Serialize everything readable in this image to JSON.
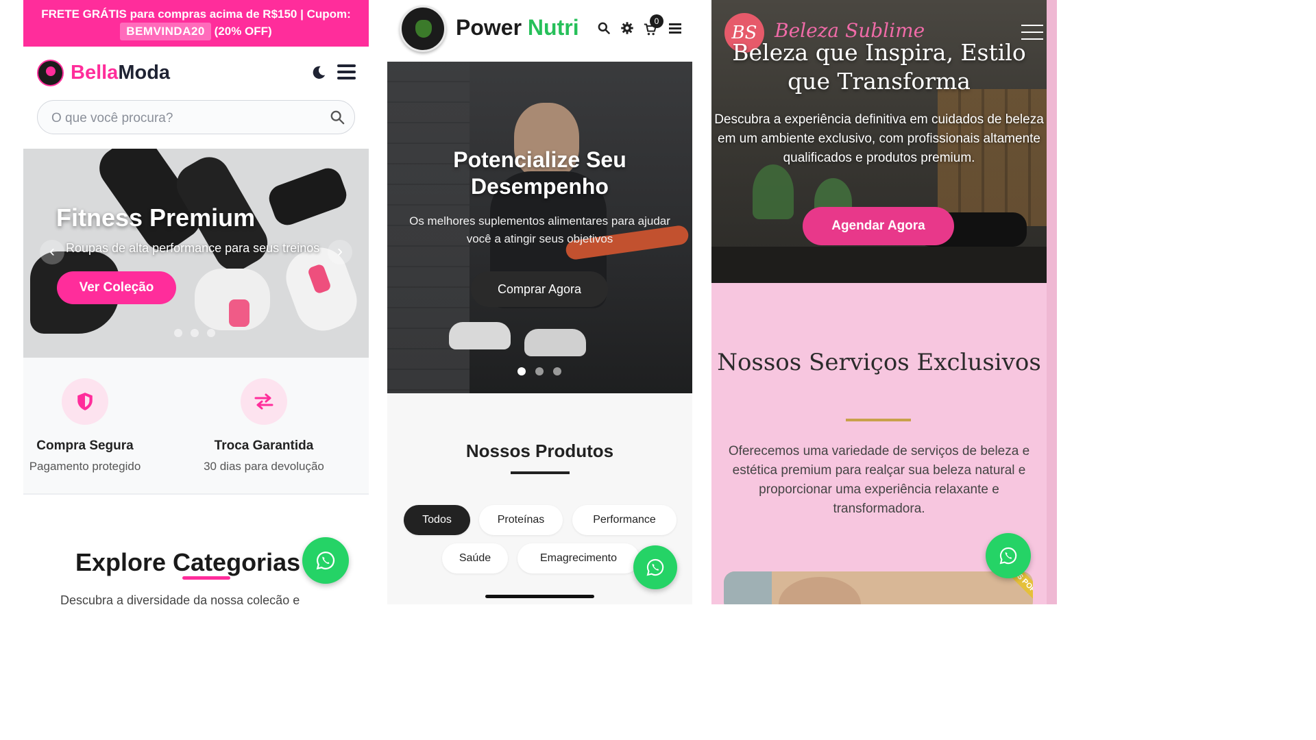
{
  "bellamoda": {
    "promo": {
      "line1": "FRETE GRÁTIS para compras acima de R$150 | Cupom:",
      "coupon": "BEMVINDA20",
      "discount": "(20% OFF)"
    },
    "brand": {
      "part1": "Bella",
      "part2": "Moda"
    },
    "search": {
      "placeholder": "O que você procura?"
    },
    "hero": {
      "title": "Fitness Premium",
      "subtitle": "Roupas de alta performance para seus treinos",
      "cta": "Ver Coleção",
      "slides": 3,
      "active_slide": 1
    },
    "features": [
      {
        "title": "Compra Segura",
        "subtitle": "Pagamento protegido",
        "icon": "shield-icon"
      },
      {
        "title": "Troca Garantida",
        "subtitle": "30 dias para devolução",
        "icon": "exchange-arrows-icon"
      }
    ],
    "section": {
      "title": "Explore Categorias",
      "subtitle": "Descubra a diversidade da nossa coleção e"
    },
    "colors": {
      "accent": "#ff2d9b",
      "text": "#1f2333"
    }
  },
  "powernutri": {
    "brand": {
      "part1": "Power",
      "part2": "Nutri"
    },
    "cart_count": "0",
    "hero": {
      "title": "Potencialize Seu Desempenho",
      "subtitle": "Os melhores suplementos alimentares para ajudar você a atingir seus objetivos",
      "cta": "Comprar Agora",
      "slides": 3,
      "active_slide": 1
    },
    "products": {
      "title": "Nossos Produtos",
      "filters": [
        "Todos",
        "Proteínas",
        "Performance",
        "Saúde",
        "Emagrecimento"
      ],
      "active_filter": "Todos"
    },
    "colors": {
      "accent": "#27c05a",
      "dark": "#222222"
    }
  },
  "belezasublime": {
    "logo_initials": "BS",
    "brand_script": "Beleza Sublime",
    "hero": {
      "title": "Beleza que Inspira, Estilo que Transforma",
      "subtitle": "Descubra a experiência definitiva em cuidados de beleza em um ambiente exclusivo, com profissionais altamente qualificados e produtos premium.",
      "cta": "Agendar Agora"
    },
    "services": {
      "title": "Nossos Serviços Exclusivos",
      "description": "Oferecemos uma variedade de serviços de beleza e estética premium para realçar sua beleza natural e proporcionar uma experiência relaxante e transformadora.",
      "ribbon": "MAIS POPULAR"
    },
    "colors": {
      "accent": "#e8388a",
      "background": "#f7c6df",
      "gold": "#c8a14a"
    }
  },
  "whatsapp": {
    "icon": "whatsapp-icon",
    "color": "#25d366"
  }
}
